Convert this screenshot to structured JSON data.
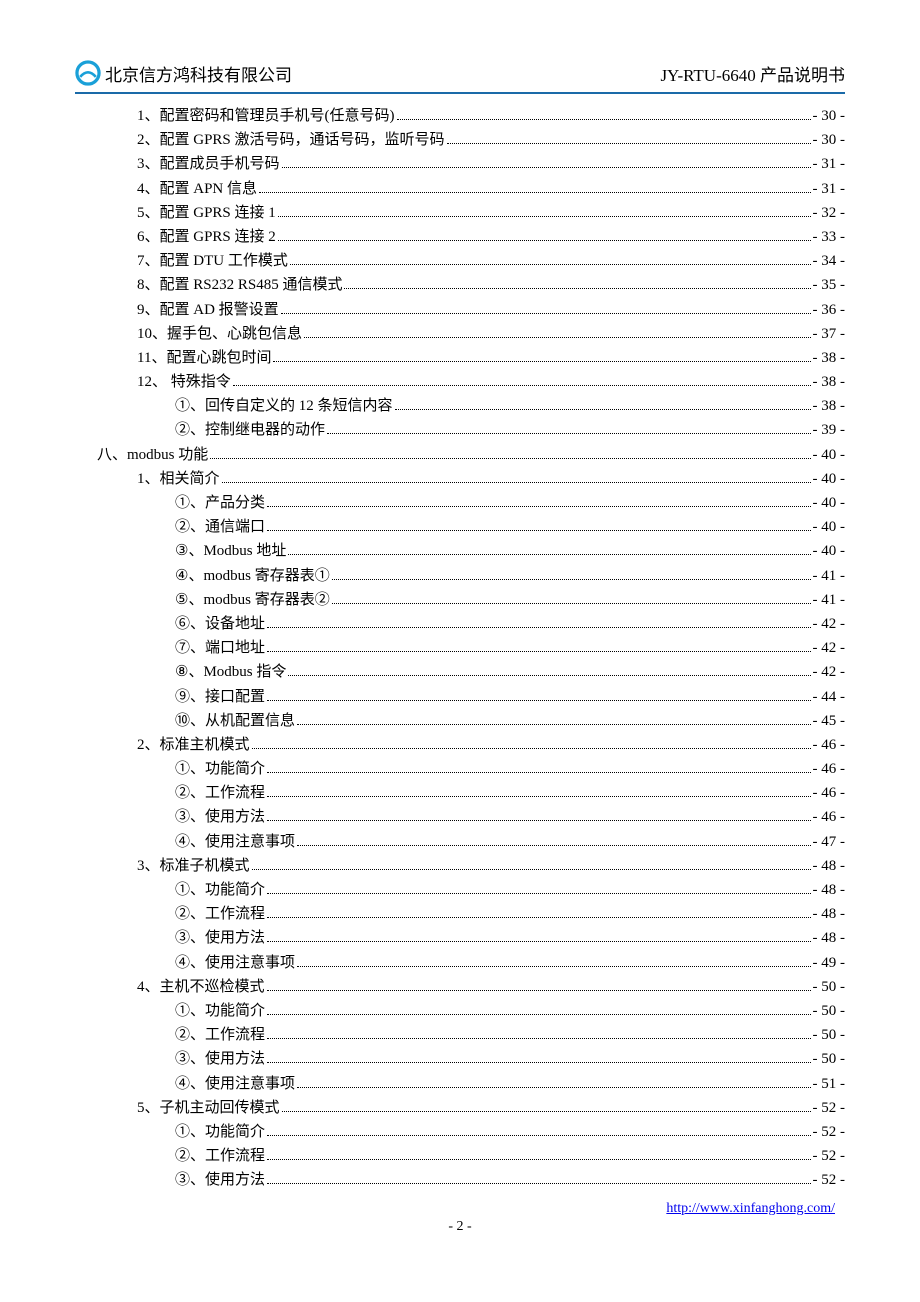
{
  "header": {
    "company": "北京信方鸿科技有限公司",
    "doc_title": "JY-RTU-6640 产品说明书"
  },
  "toc": [
    {
      "indent": 1,
      "label": "1、配置密码和管理员手机号(任意号码)",
      "page": "- 30 -"
    },
    {
      "indent": 1,
      "label": "2、配置 GPRS 激活号码，通话号码，监听号码",
      "page": "- 30 -"
    },
    {
      "indent": 1,
      "label": "3、配置成员手机号码",
      "page": "- 31 -"
    },
    {
      "indent": 1,
      "label": "4、配置 APN 信息",
      "page": "- 31 -"
    },
    {
      "indent": 1,
      "label": "5、配置 GPRS 连接 1",
      "page": "- 32 -"
    },
    {
      "indent": 1,
      "label": "6、配置 GPRS 连接 2",
      "page": "- 33 -"
    },
    {
      "indent": 1,
      "label": "7、配置 DTU 工作模式 ",
      "page": "- 34 -"
    },
    {
      "indent": 1,
      "label": "8、配置 RS232 RS485 通信模式 ",
      "page": "- 35 -"
    },
    {
      "indent": 1,
      "label": "9、配置 AD 报警设置",
      "page": "- 36 -"
    },
    {
      "indent": 1,
      "label": "10、握手包、心跳包信息",
      "page": "- 37 -"
    },
    {
      "indent": 1,
      "label": "11、配置心跳包时间",
      "page": "- 38 -"
    },
    {
      "indent": 1,
      "label": "12、 特殊指令",
      "page": "- 38 -"
    },
    {
      "indent": 2,
      "label": "①、回传自定义的 12 条短信内容",
      "page": "- 38 -"
    },
    {
      "indent": 2,
      "label": "②、控制继电器的动作",
      "page": "- 39 -"
    },
    {
      "indent": 0,
      "label": "八、modbus 功能 ",
      "page": "- 40 -"
    },
    {
      "indent": 1,
      "label": "1、相关简介",
      "page": "- 40 -"
    },
    {
      "indent": 2,
      "label": "①、产品分类 ",
      "page": "- 40 -"
    },
    {
      "indent": 2,
      "label": "②、通信端口 ",
      "page": "- 40 -"
    },
    {
      "indent": 2,
      "label": "③、Modbus 地址",
      "page": "- 40 -"
    },
    {
      "indent": 2,
      "label": "④、modbus 寄存器表①",
      "page": "- 41 -"
    },
    {
      "indent": 2,
      "label": "⑤、modbus 寄存器表②",
      "page": "- 41 -"
    },
    {
      "indent": 2,
      "label": "⑥、设备地址 ",
      "page": "- 42 -"
    },
    {
      "indent": 2,
      "label": "⑦、端口地址 ",
      "page": "- 42 -"
    },
    {
      "indent": 2,
      "label": "⑧、Modbus 指令",
      "page": "- 42 -"
    },
    {
      "indent": 2,
      "label": "⑨、接口配置 ",
      "page": "- 44 -"
    },
    {
      "indent": 2,
      "label": "⑩、从机配置信息 ",
      "page": "- 45 -"
    },
    {
      "indent": 1,
      "label": "2、标准主机模式",
      "page": "- 46 -"
    },
    {
      "indent": 2,
      "label": "①、功能简介 ",
      "page": "- 46 -"
    },
    {
      "indent": 2,
      "label": "②、工作流程 ",
      "page": "- 46 -"
    },
    {
      "indent": 2,
      "label": "③、使用方法",
      "page": "- 46 -"
    },
    {
      "indent": 2,
      "label": "④、使用注意事项",
      "page": "- 47 -"
    },
    {
      "indent": 1,
      "label": "3、标准子机模式",
      "page": "- 48 -"
    },
    {
      "indent": 2,
      "label": "①、功能简介 ",
      "page": "- 48 -"
    },
    {
      "indent": 2,
      "label": "②、工作流程 ",
      "page": "- 48 -"
    },
    {
      "indent": 2,
      "label": "③、使用方法",
      "page": "- 48 -"
    },
    {
      "indent": 2,
      "label": "④、使用注意事项",
      "page": "- 49 -"
    },
    {
      "indent": 1,
      "label": "4、主机不巡检模式",
      "page": "- 50 -"
    },
    {
      "indent": 2,
      "label": "①、功能简介 ",
      "page": "- 50 -"
    },
    {
      "indent": 2,
      "label": "②、工作流程 ",
      "page": "- 50 -"
    },
    {
      "indent": 2,
      "label": "③、使用方法",
      "page": "- 50 -"
    },
    {
      "indent": 2,
      "label": "④、使用注意事项",
      "page": "- 51 -"
    },
    {
      "indent": 1,
      "label": "5、子机主动回传模式",
      "page": "- 52 -"
    },
    {
      "indent": 2,
      "label": "①、功能简介 ",
      "page": "- 52 -"
    },
    {
      "indent": 2,
      "label": "②、工作流程 ",
      "page": "- 52 -"
    },
    {
      "indent": 2,
      "label": "③、使用方法",
      "page": "- 52 -"
    }
  ],
  "footer": {
    "link": "http://www.xinfanghong.com/",
    "page_number": "- 2 -"
  }
}
